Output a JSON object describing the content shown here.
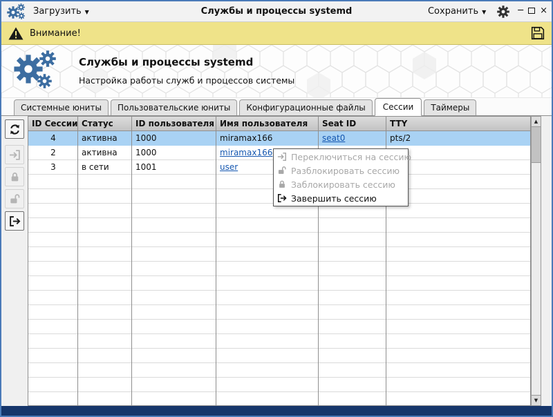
{
  "icons": {
    "dropdown": "▼",
    "minimize": "─",
    "close": "×",
    "up_arrow": "▲",
    "down_arrow": "▼"
  },
  "titlebar": {
    "load_label": "Загрузить",
    "title": "Службы и процессы systemd",
    "save_label": "Сохранить"
  },
  "warning_banner": {
    "label": "Внимание!"
  },
  "header": {
    "title": "Службы и процессы systemd",
    "subtitle": "Настройка работы служб и процессов системы"
  },
  "tabs": {
    "items": [
      {
        "label": "Системные юниты",
        "active": false
      },
      {
        "label": "Пользовательские юниты",
        "active": false
      },
      {
        "label": "Конфигурационные файлы",
        "active": false
      },
      {
        "label": "Сессии",
        "active": true
      },
      {
        "label": "Таймеры",
        "active": false
      }
    ]
  },
  "toolbar": {
    "buttons": [
      {
        "name": "refresh",
        "icon": "refresh-icon",
        "enabled": true
      },
      {
        "name": "switch-session",
        "icon": "switch-session-icon",
        "enabled": false
      },
      {
        "name": "lock-session",
        "icon": "lock-icon",
        "enabled": false
      },
      {
        "name": "unlock-session",
        "icon": "unlock-icon",
        "enabled": false
      },
      {
        "name": "end-session",
        "icon": "end-session-icon",
        "enabled": true
      }
    ]
  },
  "table": {
    "columns": [
      "ID Сессии",
      "Статус",
      "ID пользователя",
      "Имя пользователя",
      "Seat ID",
      "TTY"
    ],
    "rows": [
      {
        "id": "4",
        "status": "активна",
        "uid": "1000",
        "user": "miramax166",
        "seat": "seat0",
        "tty": "pts/2",
        "selected": true
      },
      {
        "id": "2",
        "status": "активна",
        "uid": "1000",
        "user": "miramax166",
        "seat": "",
        "tty": "",
        "selected": false
      },
      {
        "id": "3",
        "status": "в сети",
        "uid": "1001",
        "user": "user",
        "seat": "",
        "tty": "",
        "selected": false
      }
    ]
  },
  "context_menu": {
    "items": [
      {
        "label": "Переключиться на сессию",
        "enabled": false
      },
      {
        "label": "Разблокировать сессию",
        "enabled": false
      },
      {
        "label": "Заблокировать сессию",
        "enabled": false
      },
      {
        "label": "Завершить сессию",
        "enabled": true
      }
    ]
  },
  "colors": {
    "window_border": "#4a7ab8",
    "warning_bg": "#efe389",
    "selected_row": "#a9d2f4",
    "link": "#1557b0",
    "bottom_bar": "#16366b",
    "logo_blue": "#3c6da1"
  }
}
